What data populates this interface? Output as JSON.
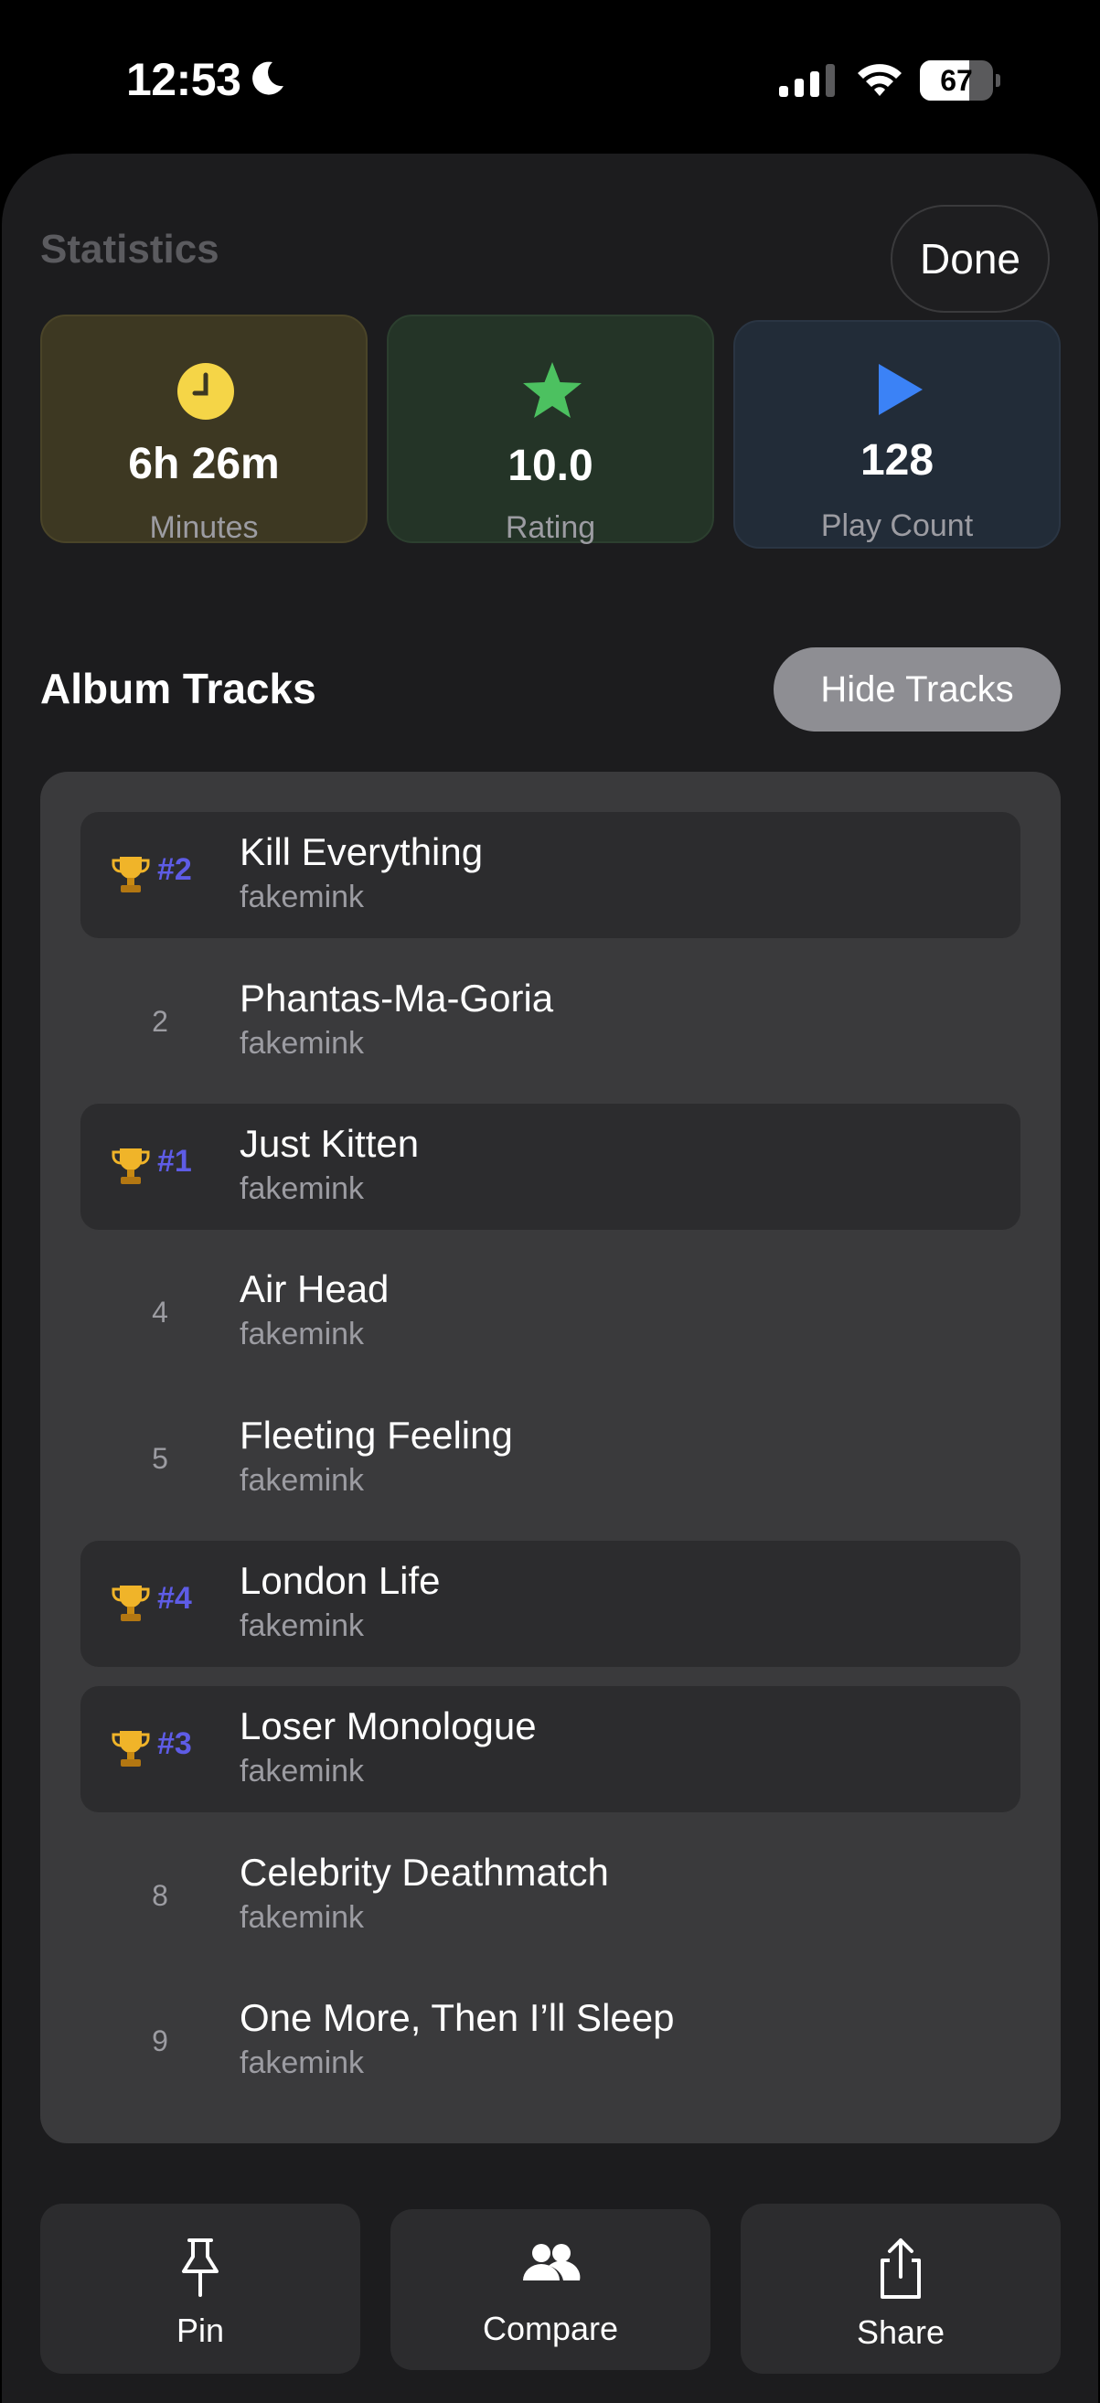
{
  "status_bar": {
    "time": "12:53",
    "battery": "67",
    "battery_level": 0.67
  },
  "sheet": {
    "title": "Statistics",
    "done_label": "Done"
  },
  "stats": [
    {
      "value": "6h 26m",
      "label": "Minutes",
      "icon": "clock-icon",
      "color": "#f5d547"
    },
    {
      "value": "10.0",
      "label": "Rating",
      "icon": "star-icon",
      "color": "#4cc160"
    },
    {
      "value": "128",
      "label": "Play Count",
      "icon": "play-icon",
      "color": "#3b82f6"
    }
  ],
  "album_tracks": {
    "title": "Album Tracks",
    "toggle_label": "Hide Tracks",
    "rank_color": "#5e5ce6",
    "tracks": [
      {
        "number": "",
        "rank": "#2",
        "title": "Kill Everything",
        "artist": "fakemink"
      },
      {
        "number": "2",
        "rank": "",
        "title": "Phantas-Ma-Goria",
        "artist": "fakemink"
      },
      {
        "number": "",
        "rank": "#1",
        "title": "Just Kitten",
        "artist": "fakemink"
      },
      {
        "number": "4",
        "rank": "",
        "title": "Air Head",
        "artist": "fakemink"
      },
      {
        "number": "5",
        "rank": "",
        "title": "Fleeting Feeling",
        "artist": "fakemink"
      },
      {
        "number": "",
        "rank": "#4",
        "title": "London Life",
        "artist": "fakemink"
      },
      {
        "number": "",
        "rank": "#3",
        "title": "Loser Monologue",
        "artist": "fakemink"
      },
      {
        "number": "8",
        "rank": "",
        "title": "Celebrity Deathmatch",
        "artist": "fakemink"
      },
      {
        "number": "9",
        "rank": "",
        "title": "One More, Then I’ll Sleep",
        "artist": "fakemink"
      }
    ]
  },
  "actions": [
    {
      "label": "Pin",
      "icon": "pin-icon"
    },
    {
      "label": "Compare",
      "icon": "people-icon"
    },
    {
      "label": "Share",
      "icon": "share-icon"
    }
  ]
}
